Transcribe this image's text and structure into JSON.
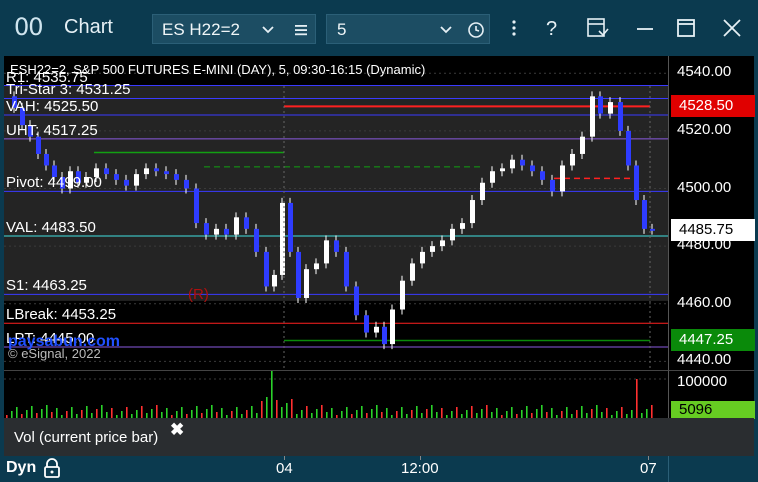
{
  "window": {
    "logo_glyph": "00",
    "title": "Chart",
    "symbol": "ES H22=2",
    "interval": "5",
    "colors": {
      "titlebar": "#0b3a4f",
      "field": "#1c4d63",
      "accent": "#1c3cc8"
    }
  },
  "chart": {
    "title_line": "ESH22=2, S&P 500 FUTURES E-MINI (DAY), 5, 09:30-16:15 (Dynamic)",
    "copyright": "© eSignal, 2022",
    "watermark": "paysabun.com",
    "study_levels": [
      {
        "label": "R1: 4535.75",
        "price": 4535.75,
        "color": "#3a3aff",
        "style": "solid"
      },
      {
        "label": "Tri-Star 3: 4531.25",
        "price": 4531.25,
        "color": "#3a3aff",
        "style": "solid"
      },
      {
        "label": "VAH: 4525.50",
        "price": 4525.5,
        "color": "#3a3aff",
        "style": "solid"
      },
      {
        "label": "UHT: 4517.25",
        "price": 4517.25,
        "color": "#8a5ae0",
        "style": "solid"
      },
      {
        "label": "Pivot: 4499.00",
        "price": 4499.0,
        "color": "#3a3aff",
        "style": "solid"
      },
      {
        "label": "VAL: 4483.50",
        "price": 4483.5,
        "color": "#40e0e0",
        "style": "solid"
      },
      {
        "label": "S1: 4463.25",
        "price": 4463.25,
        "color": "#3a3aff",
        "style": "solid"
      },
      {
        "label": "LBreak: 4453.25",
        "price": 4453.25,
        "color": "#ff2020",
        "style": "solid"
      },
      {
        "label": "LPT: 4445.00",
        "price": 4445.0,
        "color": "#8a5ae0",
        "style": "solid"
      }
    ],
    "marker_r": "(R)",
    "price_axis": {
      "ticks": [
        "4540.00",
        "4520.00",
        "4500.00",
        "4480.00",
        "4460.00",
        "4440.00"
      ],
      "tick_values": [
        4540,
        4520,
        4500,
        4480,
        4460,
        4440
      ],
      "range": [
        4437,
        4546
      ],
      "tags": [
        {
          "text": "4528.50",
          "price": 4528.5,
          "bg": "#e00000",
          "fg": "#ffffff"
        },
        {
          "text": "4485.75",
          "price": 4485.75,
          "bg": "#ffffff",
          "fg": "#000000"
        },
        {
          "text": "4447.25",
          "price": 4447.25,
          "bg": "#0a8a0a",
          "fg": "#ffffff"
        }
      ]
    }
  },
  "volume": {
    "axis_label": "100000",
    "last_value": "5096",
    "legend": "Vol (current price bar)",
    "legend_close": "✖"
  },
  "bottom_bar": {
    "mode": "Dyn",
    "time_labels": [
      "04",
      "12:00",
      "07"
    ]
  }
}
